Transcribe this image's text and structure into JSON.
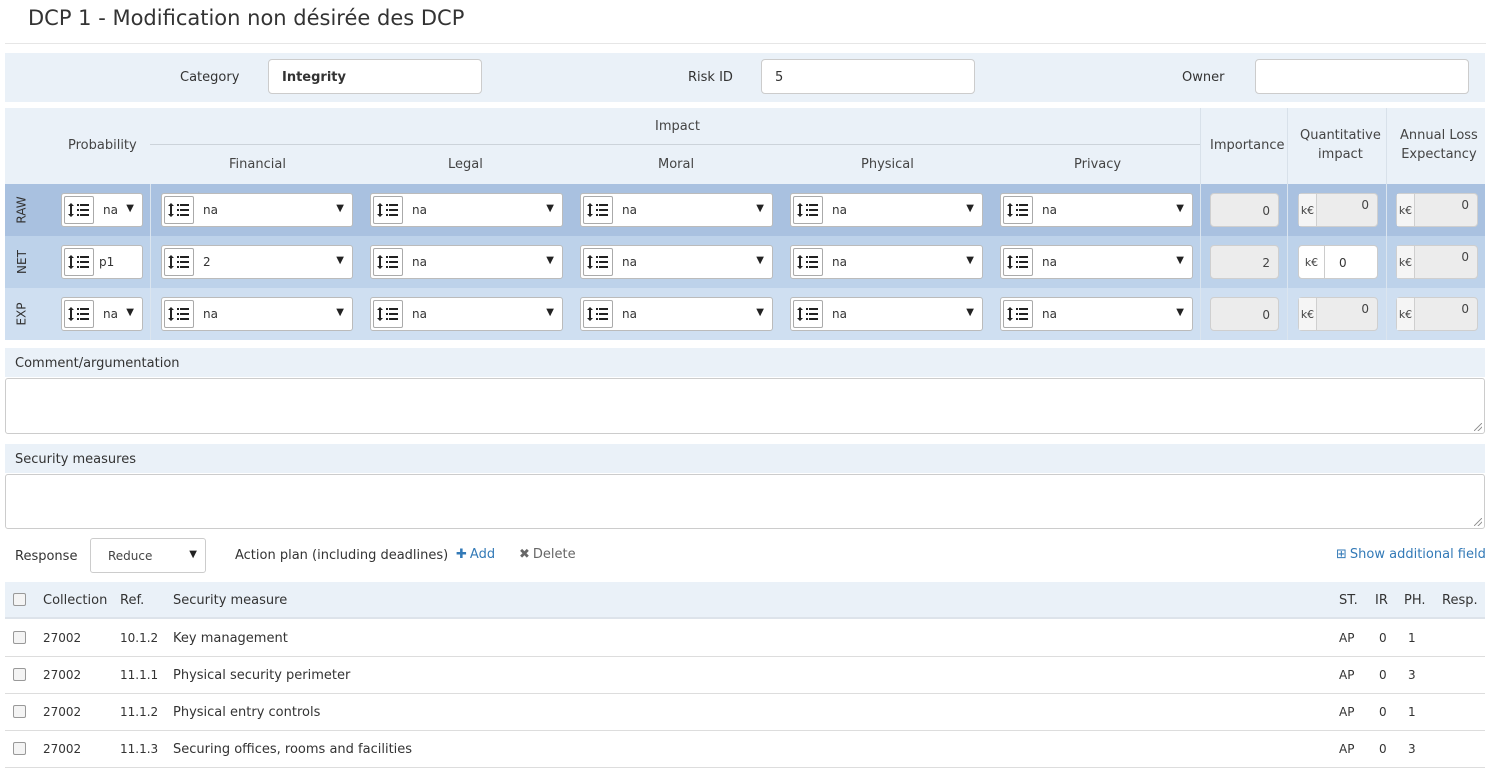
{
  "page": {
    "title": "DCP 1 - Modification non désirée des DCP"
  },
  "meta": {
    "category_label": "Category",
    "category_value": "Integrity",
    "risk_id_label": "Risk ID",
    "risk_id_value": "5",
    "owner_label": "Owner",
    "owner_value": ""
  },
  "header": {
    "probability": "Probability",
    "impact": "Impact",
    "financial": "Financial",
    "legal": "Legal",
    "moral": "Moral",
    "physical": "Physical",
    "privacy": "Privacy",
    "importance": "Importance",
    "quant_line1": "Quantitative",
    "quant_line2": "impact",
    "ale_line1": "Annual Loss",
    "ale_line2": "Expectancy"
  },
  "rows": [
    {
      "label": "RAW",
      "probability": "na",
      "financial": "na",
      "legal": "na",
      "moral": "na",
      "physical": "na",
      "privacy": "na",
      "importance": "0",
      "quant_unit": "k€",
      "quant": "0",
      "ale_unit": "k€",
      "ale": "0",
      "bg": "#a9c1e0"
    },
    {
      "label": "NET",
      "probability": "p1",
      "financial": "2",
      "legal": "na",
      "moral": "na",
      "physical": "na",
      "privacy": "na",
      "importance": "2",
      "quant_unit": "k€",
      "quant": "0",
      "ale_unit": "k€",
      "ale": "0",
      "bg": "#bdd2ea"
    },
    {
      "label": "EXP",
      "probability": "na",
      "financial": "na",
      "legal": "na",
      "moral": "na",
      "physical": "na",
      "privacy": "na",
      "importance": "0",
      "quant_unit": "k€",
      "quant": "0",
      "ale_unit": "k€",
      "ale": "0",
      "bg": "#cfdff1"
    }
  ],
  "comment": {
    "label": "Comment/argumentation",
    "value": ""
  },
  "security": {
    "label": "Security measures",
    "value": ""
  },
  "response": {
    "label": "Response",
    "value": "Reduce",
    "plan_label": "Action plan (including deadlines)",
    "add_label": "Add",
    "delete_label": "Delete",
    "show_additional": "Show additional field"
  },
  "table": {
    "headers": {
      "collection": "Collection",
      "ref": "Ref.",
      "measure": "Security measure",
      "st": "ST.",
      "ir": "IR",
      "ph": "PH.",
      "resp": "Resp."
    },
    "rows": [
      {
        "collection": "27002",
        "ref": "10.1.2",
        "measure": "Key management",
        "st": "AP",
        "ir": "0",
        "ph": "1",
        "resp": ""
      },
      {
        "collection": "27002",
        "ref": "11.1.1",
        "measure": "Physical security perimeter",
        "st": "AP",
        "ir": "0",
        "ph": "3",
        "resp": ""
      },
      {
        "collection": "27002",
        "ref": "11.1.2",
        "measure": "Physical entry controls",
        "st": "AP",
        "ir": "0",
        "ph": "1",
        "resp": ""
      },
      {
        "collection": "27002",
        "ref": "11.1.3",
        "measure": "Securing offices, rooms and facilities",
        "st": "AP",
        "ir": "0",
        "ph": "3",
        "resp": ""
      }
    ]
  },
  "icons": {
    "sort": "sort-list-icon",
    "plus": "plus-icon",
    "delete": "delete-x-icon",
    "expand": "plus-square-icon"
  },
  "colors": {
    "accent": "#337ab7",
    "panel": "#eaf1f8",
    "raw_row": "#a9c1e0",
    "net_row": "#bdd2ea",
    "exp_row": "#cfdff1"
  }
}
